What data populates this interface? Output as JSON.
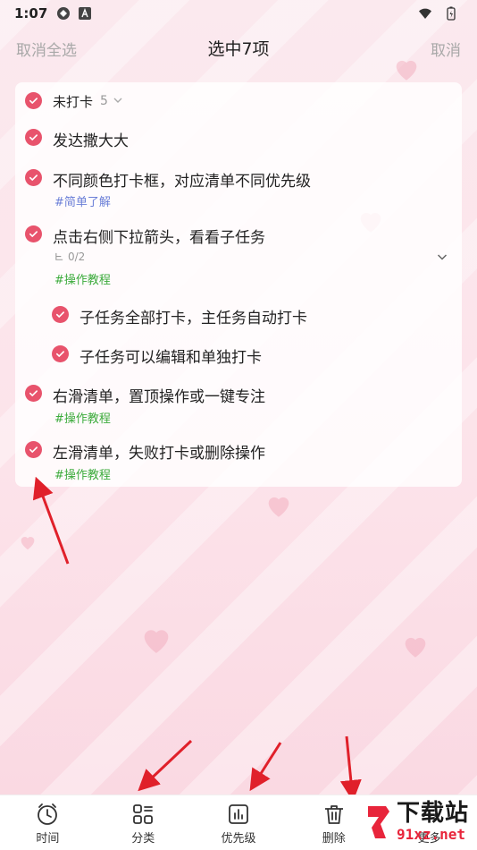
{
  "status_bar": {
    "time": "1:07"
  },
  "header": {
    "left": "取消全选",
    "title": "选中7项",
    "right": "取消"
  },
  "group": {
    "label": "未打卡",
    "count": "5"
  },
  "tasks": [
    {
      "text": "发达撒大大"
    },
    {
      "text": "不同颜色打卡框，对应清单不同优先级",
      "tag": "#简单了解"
    },
    {
      "text": "点击右侧下拉箭头，看看子任务",
      "subtasks_progress": "0/2",
      "tag": "#操作教程"
    },
    {
      "text": "子任务全部打卡，主任务自动打卡"
    },
    {
      "text": "子任务可以编辑和单独打卡"
    },
    {
      "text": "右滑清单，置顶操作或一键专注",
      "tag": "#操作教程"
    },
    {
      "text": "左滑清单，失败打卡或删除操作",
      "tag": "#操作教程"
    }
  ],
  "bottom_bar": [
    {
      "label": "时间",
      "icon": "clock-icon"
    },
    {
      "label": "分类",
      "icon": "grid-icon"
    },
    {
      "label": "优先级",
      "icon": "bar-chart-icon"
    },
    {
      "label": "删除",
      "icon": "trash-icon"
    },
    {
      "label": "更多",
      "icon": "more-icon"
    }
  ],
  "watermark": {
    "cn": "下载站",
    "en": "91xz.net"
  },
  "colors": {
    "accent": "#e8536c",
    "tag_blue": "#6b7fd7",
    "tag_green": "#3cab3c",
    "arrow": "#e0202a"
  }
}
